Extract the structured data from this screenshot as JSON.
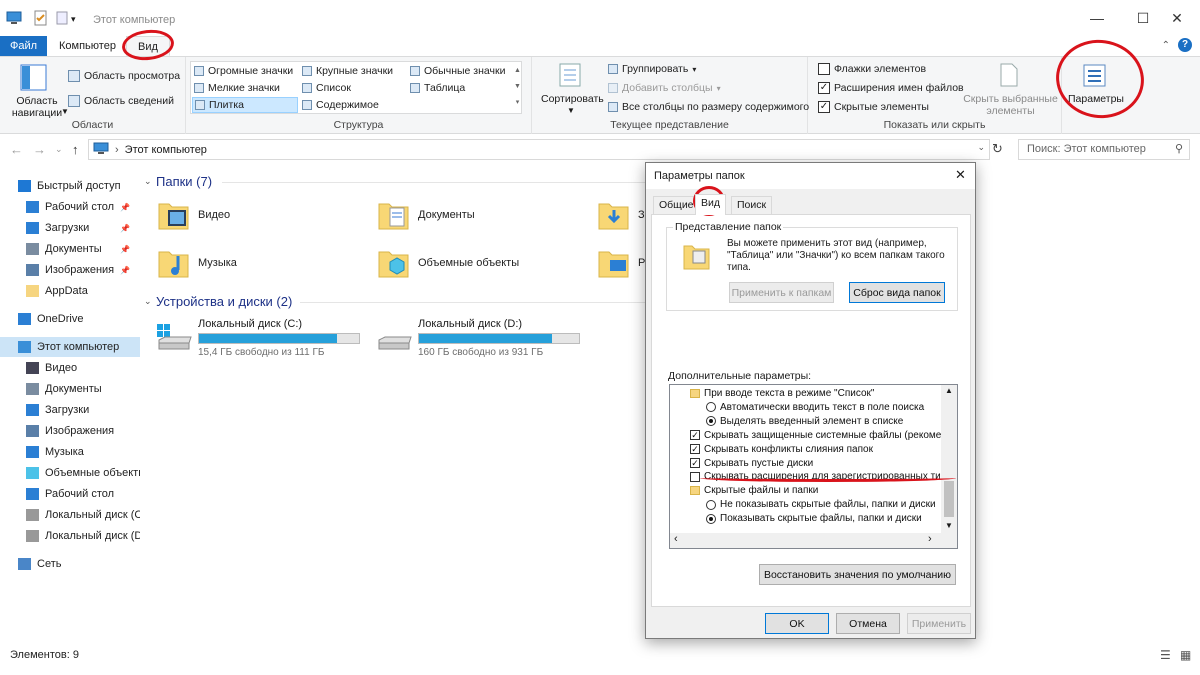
{
  "window": {
    "title": "Этот компьютер"
  },
  "tabs": {
    "file": "Файл",
    "computer": "Компьютер",
    "view": "Вид"
  },
  "ribbon": {
    "panes": {
      "nav_pane": "Область навигации",
      "preview": "Область просмотра",
      "details": "Область сведений",
      "label": "Области"
    },
    "layout": {
      "items": [
        "Огромные значки",
        "Крупные значки",
        "Обычные значки",
        "Мелкие значки",
        "Список",
        "Таблица",
        "Плитка",
        "Содержимое"
      ],
      "label": "Структура"
    },
    "current": {
      "sort": "Сортировать",
      "group": "Группировать",
      "add_columns": "Добавить столбцы",
      "fit_columns": "Все столбцы по размеру содержимого",
      "label": "Текущее представление"
    },
    "showhide": {
      "item_checkboxes": "Флажки элементов",
      "extensions": "Расширения имен файлов",
      "hidden_items": "Скрытые элементы",
      "hide_selected": "Скрыть выбранные элементы",
      "label": "Показать или скрыть"
    },
    "options": "Параметры"
  },
  "address": {
    "path": "Этот компьютер",
    "search_placeholder": "Поиск: Этот компьютер"
  },
  "sidebar": {
    "items": [
      "Быстрый доступ",
      "Рабочий стол",
      "Загрузки",
      "Документы",
      "Изображения",
      "AppData",
      "OneDrive",
      "Этот компьютер",
      "Видео",
      "Документы",
      "Загрузки",
      "Изображения",
      "Музыка",
      "Объемные объекты",
      "Рабочий стол",
      "Локальный диск (C:)",
      "Локальный диск (D:)",
      "Сеть"
    ]
  },
  "main": {
    "folders_header": "Папки (7)",
    "folders": [
      "Видео",
      "Документы",
      "З",
      "Музыка",
      "Объемные объекты",
      "Р"
    ],
    "devices_header": "Устройства и диски (2)",
    "disks": [
      {
        "name": "Локальный диск (C:)",
        "free": "15,4 ГБ свободно из 111 ГБ",
        "used_fraction": 0.86
      },
      {
        "name": "Локальный диск (D:)",
        "free": "160 ГБ свободно из 931 ГБ",
        "used_fraction": 0.83
      }
    ]
  },
  "status": {
    "count": "Элементов: 9"
  },
  "dialog": {
    "title": "Параметры папок",
    "tabs": [
      "Общие",
      "Вид",
      "Поиск"
    ],
    "folder_views_label": "Представление папок",
    "folder_views_text": "Вы можете применить этот вид (например, \"Таблица\" или \"Значки\") ко всем папкам такого типа.",
    "apply_to_folders": "Применить к папкам",
    "reset_folders": "Сброс вида папок",
    "advanced_label": "Дополнительные параметры:",
    "tree": [
      {
        "type": "folder",
        "text": "При вводе текста в режиме \"Список\""
      },
      {
        "type": "radio",
        "on": false,
        "text": "Автоматически вводить текст в поле поиска"
      },
      {
        "type": "radio",
        "on": true,
        "text": "Выделять введенный элемент в списке"
      },
      {
        "type": "check",
        "on": true,
        "text": "Скрывать защищенные системные файлы (рекомен"
      },
      {
        "type": "check",
        "on": true,
        "text": "Скрывать конфликты слияния папок"
      },
      {
        "type": "check",
        "on": true,
        "text": "Скрывать пустые диски"
      },
      {
        "type": "check",
        "on": false,
        "text": "Скрывать расширения для зарегистрированных типо"
      },
      {
        "type": "folder",
        "text": "Скрытые файлы и папки"
      },
      {
        "type": "radio",
        "on": false,
        "text": "Не показывать скрытые файлы, папки и диски"
      },
      {
        "type": "radio",
        "on": true,
        "text": "Показывать скрытые файлы, папки и диски"
      }
    ],
    "restore_defaults": "Восстановить значения по умолчанию",
    "ok": "OK",
    "cancel": "Отмена",
    "apply": "Применить"
  },
  "colors": {
    "accent": "#1a6fc4",
    "annotation": "#d9131b",
    "progress": "#26a0da"
  }
}
